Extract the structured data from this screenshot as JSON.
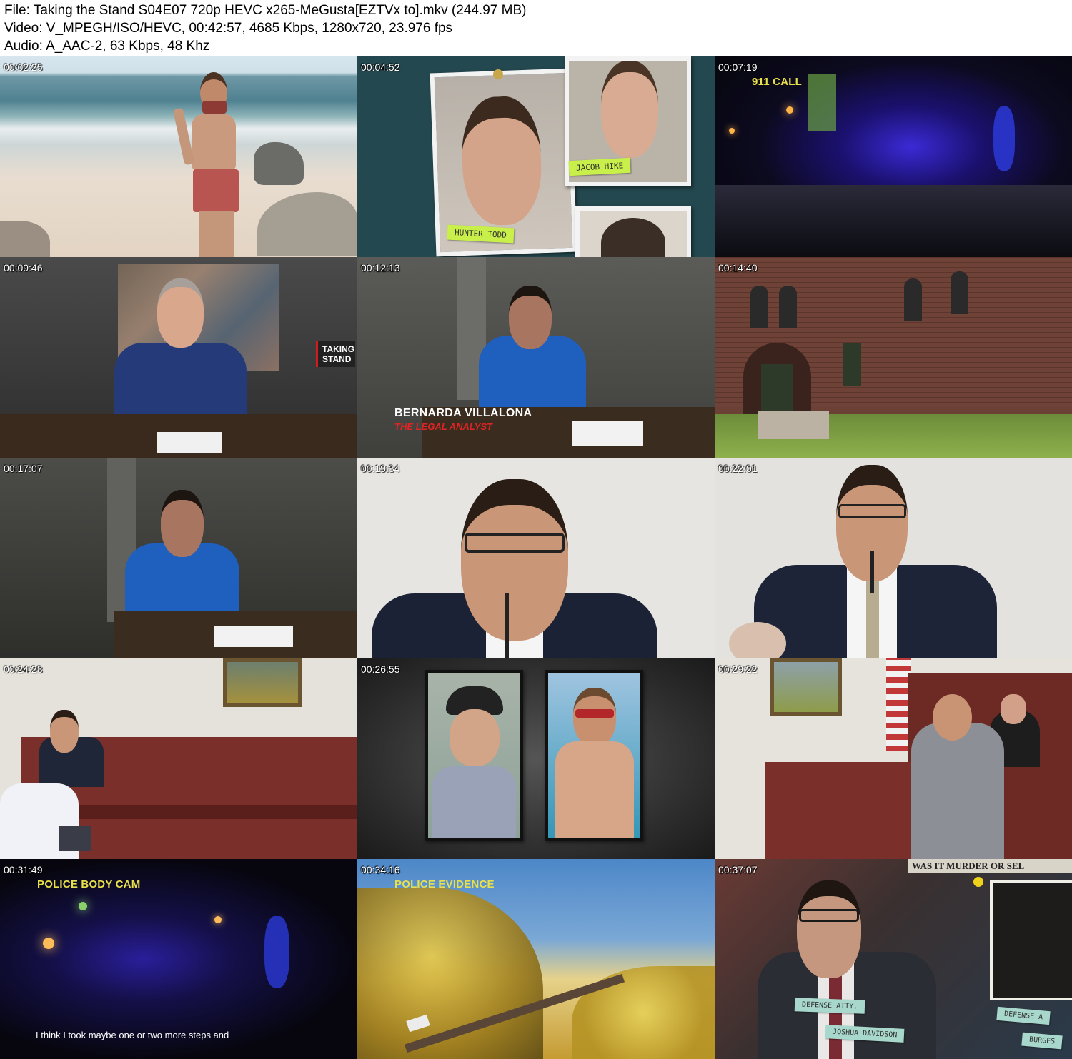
{
  "header": {
    "file_line": "File: Taking the Stand S04E07 720p HEVC x265-MeGusta[EZTVx to].mkv (244.97 MB)",
    "video_line": "Video: V_MPEGH/ISO/HEVC, 00:42:57, 4685 Kbps, 1280x720, 23.976 fps",
    "audio_line": "Audio: A_AAC-2, 63 Kbps, 48 Khz"
  },
  "thumbnails": [
    {
      "time": "00:02:25"
    },
    {
      "time": "00:04:52",
      "note_1": "JACOB HIKE",
      "note_2": "HUNTER TODD"
    },
    {
      "time": "00:07:19",
      "caption": "911 CALL"
    },
    {
      "time": "00:09:46",
      "logo": "TAKING STAND"
    },
    {
      "time": "00:12:13",
      "name": "BERNARDA VILLALONA",
      "role": "THE LEGAL ANALYST"
    },
    {
      "time": "00:14:40"
    },
    {
      "time": "00:17:07"
    },
    {
      "time": "00:19:34"
    },
    {
      "time": "00:22:01"
    },
    {
      "time": "00:24:28"
    },
    {
      "time": "00:26:55"
    },
    {
      "time": "00:29:22"
    },
    {
      "time": "00:31:49",
      "caption": "POLICE BODY CAM",
      "subtitle": "I think I took maybe one or two more steps and"
    },
    {
      "time": "00:34:16",
      "caption": "POLICE EVIDENCE"
    },
    {
      "time": "00:37:07",
      "banner": "WAS IT MURDER OR SEL",
      "tag_1": "DEFENSE ATTY.",
      "tag_2": "JOSHUA DAVIDSON",
      "tag_3": "DEFENSE A",
      "tag_4": "BURGES"
    }
  ],
  "colors": {
    "caption_yellow": "#e8e04a",
    "sticky_green": "#c9f04a",
    "tag_teal": "#a8d8cc",
    "role_red": "#e02424"
  }
}
